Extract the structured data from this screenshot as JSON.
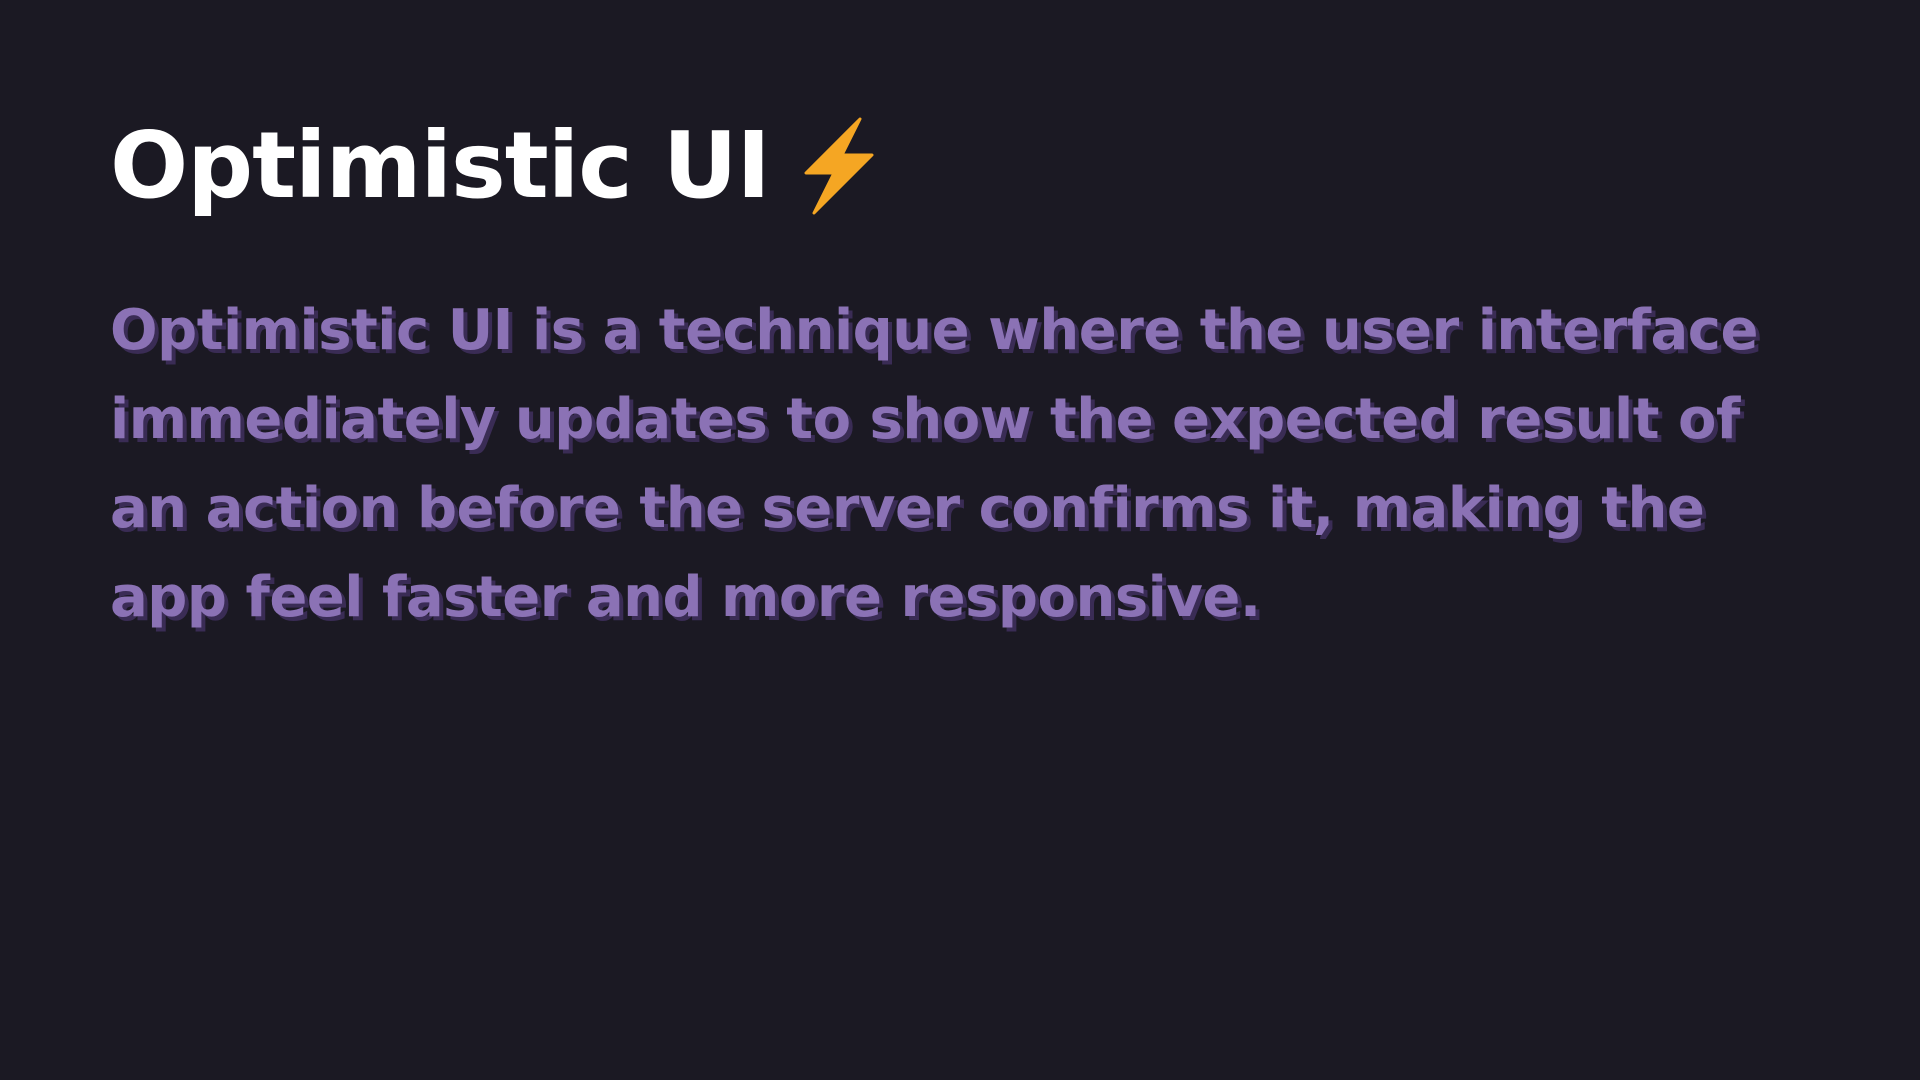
{
  "slide": {
    "title": "Optimistic UI",
    "title_icon": "lightning-bolt-icon",
    "body": "Optimistic UI is a technique where the user interface immediately updates to show the expected result of an action before the server confirms it, making the app feel faster and more responsive."
  },
  "colors": {
    "background": "#1b1923",
    "title": "#ffffff",
    "body": "#8b72b5",
    "body_shadow": "#3a2c55",
    "bolt": "#f5a623"
  }
}
